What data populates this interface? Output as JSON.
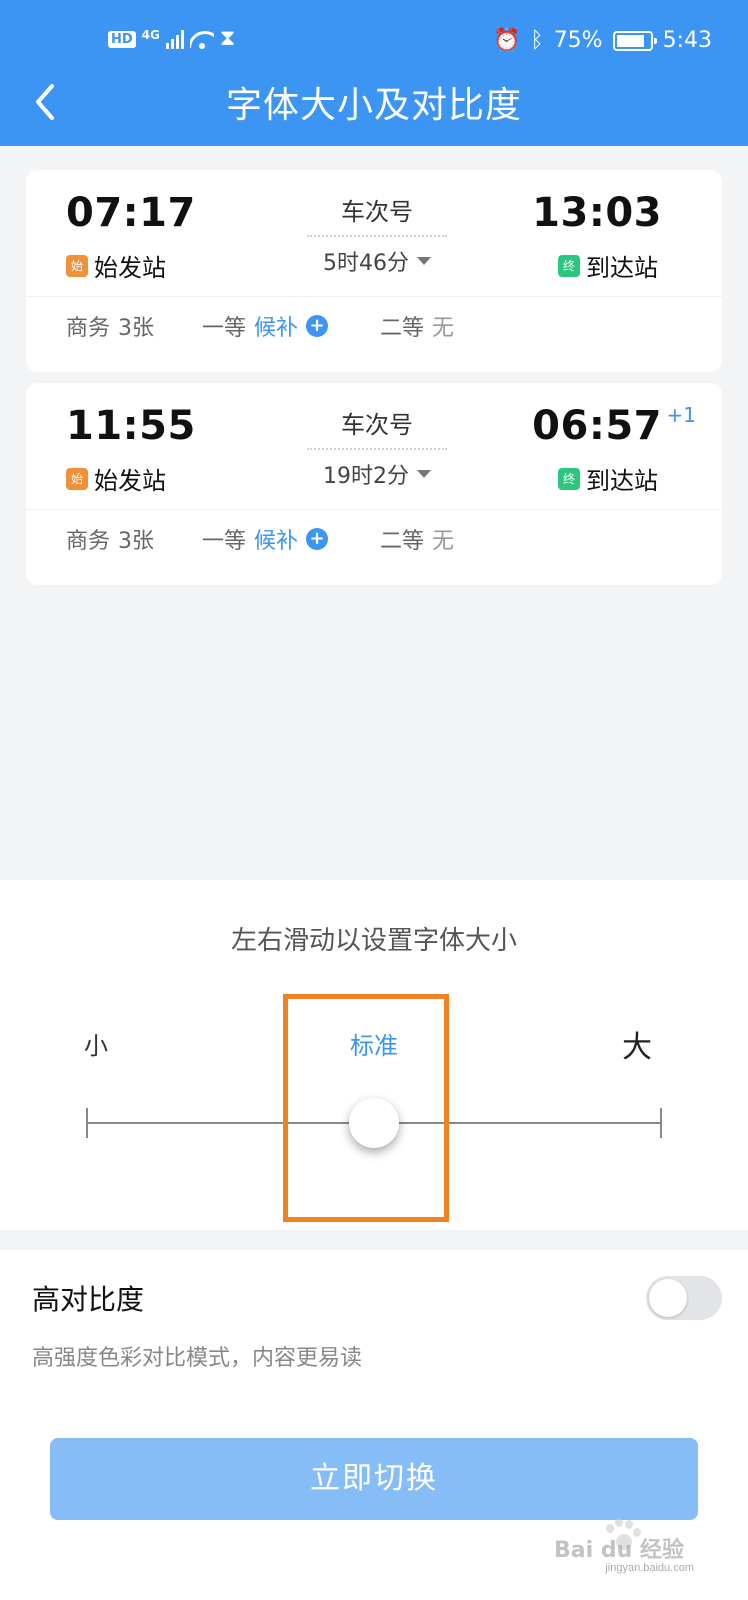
{
  "status_bar": {
    "hd": "HD",
    "network": "4G",
    "battery_pct": "75%",
    "time": "5:43",
    "icons": [
      "signal-icon",
      "wifi-icon",
      "hourglass-icon",
      "alarm-icon",
      "bluetooth-icon",
      "battery-icon"
    ]
  },
  "header": {
    "title": "字体大小及对比度",
    "back_icon": "chevron-left-icon"
  },
  "trains": [
    {
      "depart_time": "07:17",
      "depart_tag": "始",
      "depart_station": "始发站",
      "train_no": "车次号",
      "duration": "5时46分",
      "arrive_time": "13:03",
      "arrive_tag": "终",
      "arrive_station": "到达站",
      "day_offset": "",
      "seats": {
        "business": {
          "label": "商务",
          "value": "3张"
        },
        "first": {
          "label": "一等",
          "value": "候补"
        },
        "second": {
          "label": "二等",
          "value": "无"
        }
      }
    },
    {
      "depart_time": "11:55",
      "depart_tag": "始",
      "depart_station": "始发站",
      "train_no": "车次号",
      "duration": "19时2分",
      "arrive_time": "06:57",
      "arrive_tag": "终",
      "arrive_station": "到达站",
      "day_offset": "+1",
      "seats": {
        "business": {
          "label": "商务",
          "value": "3张"
        },
        "first": {
          "label": "一等",
          "value": "候补"
        },
        "second": {
          "label": "二等",
          "value": "无"
        }
      }
    }
  ],
  "font_size": {
    "hint": "左右滑动以设置字体大小",
    "small_label": "小",
    "standard_label": "标准",
    "large_label": "大",
    "slider_value": 0.5
  },
  "contrast": {
    "title": "高对比度",
    "description": "高强度色彩对比模式，内容更易读",
    "enabled": false
  },
  "apply_button": "立即切换",
  "watermark": {
    "text": "Bai du 经验",
    "url": "jingyan.baidu.com"
  },
  "colors": {
    "accent": "#3d95f3",
    "highlight_box": "#f08224",
    "button": "#86bdf7"
  }
}
